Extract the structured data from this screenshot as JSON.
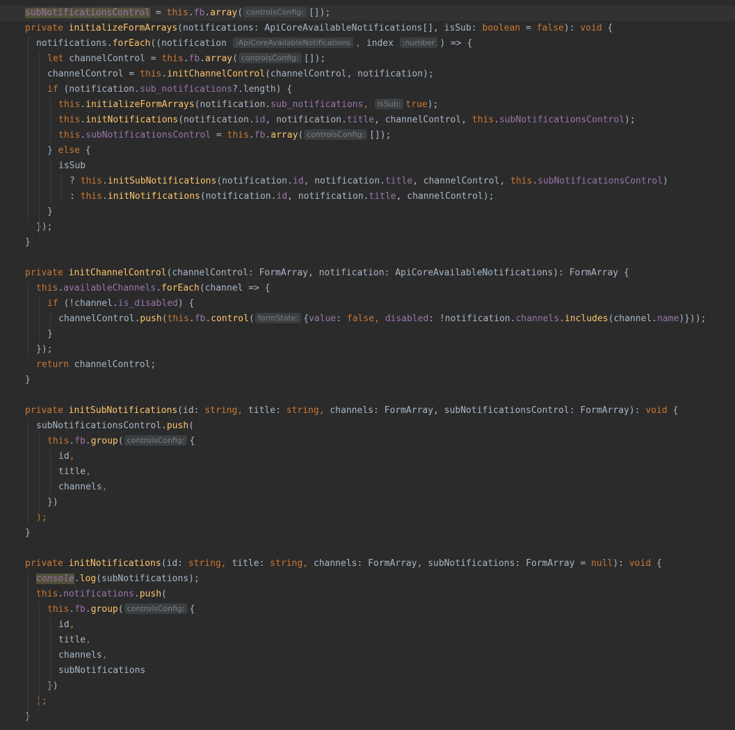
{
  "colors": {
    "background": "#2b2b2b",
    "keyword": "#cc7832",
    "function": "#ffc66d",
    "property": "#9876aa",
    "plain": "#a9b7c6",
    "hint_background": "#3b3f41",
    "hint_text": "#7a7e85",
    "selection_highlight": "#52503a"
  },
  "editor": {
    "lines": [
      {
        "indent": 0,
        "segments": [
          [
            "subNotificationsControl",
            "p hl"
          ],
          [
            " = ",
            "t"
          ],
          [
            "this",
            "k"
          ],
          [
            ".",
            "t"
          ],
          [
            "fb",
            "p"
          ],
          [
            ".",
            "t"
          ],
          [
            "array",
            "fn"
          ],
          [
            "(",
            "t"
          ],
          [
            "controlsConfig:",
            "hint"
          ],
          [
            "[]);",
            "t"
          ]
        ]
      },
      {
        "indent": 0,
        "segments": [
          [
            "private ",
            "k"
          ],
          [
            "initializeFormArrays",
            "fn"
          ],
          [
            "(notifications: ApiCoreAvailableNotifications[], isSub: ",
            "t"
          ],
          [
            "boolean",
            "k"
          ],
          [
            " = ",
            "t"
          ],
          [
            "false",
            "k"
          ],
          [
            "): ",
            "t"
          ],
          [
            "void",
            "k"
          ],
          [
            " {",
            "t"
          ]
        ]
      },
      {
        "indent": 1,
        "segments": [
          [
            "notifications.",
            "t"
          ],
          [
            "forEach",
            "fn"
          ],
          [
            "((notification ",
            "t"
          ],
          [
            ":ApiCoreAvailableNotifications",
            "hint"
          ],
          [
            ", ",
            "k"
          ],
          [
            "index ",
            "t"
          ],
          [
            ":number",
            "hint"
          ],
          [
            ") => {",
            "t"
          ]
        ]
      },
      {
        "indent": 2,
        "segments": [
          [
            "let ",
            "k"
          ],
          [
            "channelControl = ",
            "t"
          ],
          [
            "this",
            "k"
          ],
          [
            ".",
            "t"
          ],
          [
            "fb",
            "p"
          ],
          [
            ".",
            "t"
          ],
          [
            "array",
            "fn"
          ],
          [
            "(",
            "t"
          ],
          [
            "controlsConfig:",
            "hint"
          ],
          [
            "[]);",
            "t"
          ]
        ]
      },
      {
        "indent": 2,
        "segments": [
          [
            "channelControl = ",
            "t"
          ],
          [
            "this",
            "k"
          ],
          [
            ".",
            "t"
          ],
          [
            "initChannelControl",
            "fn"
          ],
          [
            "(channelControl, notification);",
            "t"
          ]
        ]
      },
      {
        "indent": 2,
        "segments": [
          [
            "if ",
            "k"
          ],
          [
            "(notification.",
            "t"
          ],
          [
            "sub_notifications",
            "p"
          ],
          [
            "?.length) {",
            "t"
          ]
        ]
      },
      {
        "indent": 3,
        "segments": [
          [
            "this",
            "k"
          ],
          [
            ".",
            "t"
          ],
          [
            "initializeFormArrays",
            "fn"
          ],
          [
            "(notification.",
            "t"
          ],
          [
            "sub_notifications",
            "p"
          ],
          [
            ", ",
            "k"
          ],
          [
            "isSub:",
            "hint"
          ],
          [
            "true",
            "k"
          ],
          [
            ");",
            "t"
          ]
        ]
      },
      {
        "indent": 3,
        "segments": [
          [
            "this",
            "k"
          ],
          [
            ".",
            "t"
          ],
          [
            "initNotifications",
            "fn"
          ],
          [
            "(notification.",
            "t"
          ],
          [
            "id",
            "p"
          ],
          [
            ", notification.",
            "t"
          ],
          [
            "title",
            "p"
          ],
          [
            ", channelControl, ",
            "t"
          ],
          [
            "this",
            "k"
          ],
          [
            ".",
            "t"
          ],
          [
            "subNotificationsControl",
            "p"
          ],
          [
            ");",
            "t"
          ]
        ]
      },
      {
        "indent": 3,
        "segments": [
          [
            "this",
            "k"
          ],
          [
            ".",
            "t"
          ],
          [
            "subNotificationsControl",
            "p"
          ],
          [
            " = ",
            "t"
          ],
          [
            "this",
            "k"
          ],
          [
            ".",
            "t"
          ],
          [
            "fb",
            "p"
          ],
          [
            ".",
            "t"
          ],
          [
            "array",
            "fn"
          ],
          [
            "(",
            "t"
          ],
          [
            "controlsConfig:",
            "hint"
          ],
          [
            "[]);",
            "t"
          ]
        ]
      },
      {
        "indent": 2,
        "segments": [
          [
            "} ",
            "t"
          ],
          [
            "else",
            "k"
          ],
          [
            " {",
            "t"
          ]
        ]
      },
      {
        "indent": 3,
        "segments": [
          [
            "isSub",
            "t"
          ]
        ]
      },
      {
        "indent": 4,
        "segments": [
          [
            "? ",
            "t"
          ],
          [
            "this",
            "k"
          ],
          [
            ".",
            "t"
          ],
          [
            "initSubNotifications",
            "fn"
          ],
          [
            "(notification.",
            "t"
          ],
          [
            "id",
            "p"
          ],
          [
            ", notification.",
            "t"
          ],
          [
            "title",
            "p"
          ],
          [
            ", channelControl, ",
            "t"
          ],
          [
            "this",
            "k"
          ],
          [
            ".",
            "t"
          ],
          [
            "subNotificationsControl",
            "p"
          ],
          [
            ")",
            "t"
          ]
        ]
      },
      {
        "indent": 4,
        "segments": [
          [
            ": ",
            "t"
          ],
          [
            "this",
            "k"
          ],
          [
            ".",
            "t"
          ],
          [
            "initNotifications",
            "fn"
          ],
          [
            "(notification.",
            "t"
          ],
          [
            "id",
            "p"
          ],
          [
            ", notification.",
            "t"
          ],
          [
            "title",
            "p"
          ],
          [
            ", channelControl);",
            "t"
          ]
        ]
      },
      {
        "indent": 2,
        "segments": [
          [
            "}",
            "t"
          ]
        ]
      },
      {
        "indent": 1,
        "segments": [
          [
            "});",
            "t"
          ]
        ]
      },
      {
        "indent": 0,
        "segments": [
          [
            "}",
            "t"
          ]
        ]
      },
      {
        "indent": 0,
        "segments": []
      },
      {
        "indent": 0,
        "segments": [
          [
            "private ",
            "k"
          ],
          [
            "initChannelControl",
            "fn"
          ],
          [
            "(channelControl: FormArray, notification: ApiCoreAvailableNotifications): FormArray {",
            "t"
          ]
        ]
      },
      {
        "indent": 1,
        "segments": [
          [
            "this",
            "k"
          ],
          [
            ".",
            "t"
          ],
          [
            "availableChannels",
            "p"
          ],
          [
            ".",
            "t"
          ],
          [
            "forEach",
            "fn"
          ],
          [
            "(channel => {",
            "t"
          ]
        ]
      },
      {
        "indent": 2,
        "segments": [
          [
            "if ",
            "k"
          ],
          [
            "(!channel.",
            "t"
          ],
          [
            "is_disabled",
            "p"
          ],
          [
            ") {",
            "t"
          ]
        ]
      },
      {
        "indent": 3,
        "segments": [
          [
            "channelControl.",
            "t"
          ],
          [
            "push",
            "fn"
          ],
          [
            "(",
            "t"
          ],
          [
            "this",
            "k"
          ],
          [
            ".",
            "t"
          ],
          [
            "fb",
            "p"
          ],
          [
            ".",
            "t"
          ],
          [
            "control",
            "fn"
          ],
          [
            "(",
            "t"
          ],
          [
            "formState:",
            "hint"
          ],
          [
            "{",
            "t"
          ],
          [
            "value",
            "p"
          ],
          [
            ": ",
            "t"
          ],
          [
            "false",
            "k"
          ],
          [
            ", ",
            "k"
          ],
          [
            "disabled",
            "p"
          ],
          [
            ": !notification.",
            "t"
          ],
          [
            "channels",
            "p"
          ],
          [
            ".",
            "t"
          ],
          [
            "includes",
            "fn"
          ],
          [
            "(channel.",
            "t"
          ],
          [
            "name",
            "p"
          ],
          [
            ")}));",
            "t"
          ]
        ]
      },
      {
        "indent": 2,
        "segments": [
          [
            "}",
            "t"
          ]
        ]
      },
      {
        "indent": 1,
        "segments": [
          [
            "});",
            "t"
          ]
        ]
      },
      {
        "indent": 1,
        "segments": [
          [
            "return ",
            "k"
          ],
          [
            "channelControl;",
            "t"
          ]
        ]
      },
      {
        "indent": 0,
        "segments": [
          [
            "}",
            "t"
          ]
        ]
      },
      {
        "indent": 0,
        "segments": []
      },
      {
        "indent": 0,
        "segments": [
          [
            "private ",
            "k"
          ],
          [
            "initSubNotifications",
            "fn"
          ],
          [
            "(id: ",
            "t"
          ],
          [
            "string",
            "k"
          ],
          [
            ", ",
            "k"
          ],
          [
            "title: ",
            "t"
          ],
          [
            "string",
            "k"
          ],
          [
            ", ",
            "k"
          ],
          [
            "channels: FormArray, subNotificationsControl: FormArray): ",
            "t"
          ],
          [
            "void",
            "k"
          ],
          [
            " {",
            "t"
          ]
        ]
      },
      {
        "indent": 1,
        "segments": [
          [
            "subNotificationsControl.",
            "t"
          ],
          [
            "push",
            "fn"
          ],
          [
            "(",
            "t"
          ]
        ]
      },
      {
        "indent": 2,
        "segments": [
          [
            "this",
            "k"
          ],
          [
            ".",
            "t"
          ],
          [
            "fb",
            "p"
          ],
          [
            ".",
            "t"
          ],
          [
            "group",
            "fn"
          ],
          [
            "(",
            "t"
          ],
          [
            "controlsConfig:",
            "hint"
          ],
          [
            "{",
            "t"
          ]
        ]
      },
      {
        "indent": 3,
        "segments": [
          [
            "id",
            "t"
          ],
          [
            ",",
            "k"
          ]
        ]
      },
      {
        "indent": 3,
        "segments": [
          [
            "title",
            "t"
          ],
          [
            ",",
            "k"
          ]
        ]
      },
      {
        "indent": 3,
        "segments": [
          [
            "channels",
            "t"
          ],
          [
            ",",
            "k"
          ]
        ]
      },
      {
        "indent": 2,
        "segments": [
          [
            "})",
            "t"
          ]
        ]
      },
      {
        "indent": 1,
        "segments": [
          [
            ");",
            "k"
          ]
        ]
      },
      {
        "indent": 0,
        "segments": [
          [
            "}",
            "t"
          ]
        ]
      },
      {
        "indent": 0,
        "segments": []
      },
      {
        "indent": 0,
        "segments": [
          [
            "private ",
            "k"
          ],
          [
            "initNotifications",
            "fn"
          ],
          [
            "(id: ",
            "t"
          ],
          [
            "string",
            "k"
          ],
          [
            ", ",
            "k"
          ],
          [
            "title: ",
            "t"
          ],
          [
            "string",
            "k"
          ],
          [
            ", ",
            "k"
          ],
          [
            "channels: FormArray, subNotifications: FormArray = ",
            "t"
          ],
          [
            "null",
            "k"
          ],
          [
            "): ",
            "t"
          ],
          [
            "void",
            "k"
          ],
          [
            " {",
            "t"
          ]
        ]
      },
      {
        "indent": 1,
        "segments": [
          [
            "console",
            "p it hl"
          ],
          [
            ".",
            "t"
          ],
          [
            "log",
            "fn"
          ],
          [
            "(subNotifications);",
            "t"
          ]
        ]
      },
      {
        "indent": 1,
        "segments": [
          [
            "this",
            "k"
          ],
          [
            ".",
            "t"
          ],
          [
            "notifications",
            "p"
          ],
          [
            ".",
            "t"
          ],
          [
            "push",
            "fn"
          ],
          [
            "(",
            "t"
          ]
        ]
      },
      {
        "indent": 2,
        "segments": [
          [
            "this",
            "k"
          ],
          [
            ".",
            "t"
          ],
          [
            "fb",
            "p"
          ],
          [
            ".",
            "t"
          ],
          [
            "group",
            "fn"
          ],
          [
            "(",
            "t"
          ],
          [
            "controlsConfig:",
            "hint"
          ],
          [
            "{",
            "t"
          ]
        ]
      },
      {
        "indent": 3,
        "segments": [
          [
            "id",
            "t"
          ],
          [
            ",",
            "k"
          ]
        ]
      },
      {
        "indent": 3,
        "segments": [
          [
            "title",
            "t"
          ],
          [
            ",",
            "k"
          ]
        ]
      },
      {
        "indent": 3,
        "segments": [
          [
            "channels",
            "t"
          ],
          [
            ",",
            "k"
          ]
        ]
      },
      {
        "indent": 3,
        "segments": [
          [
            "subNotifications",
            "t"
          ]
        ]
      },
      {
        "indent": 2,
        "segments": [
          [
            "})",
            "t"
          ]
        ]
      },
      {
        "indent": 1,
        "segments": [
          [
            ");",
            "k"
          ]
        ]
      },
      {
        "indent": 0,
        "segments": [
          [
            "}",
            "t"
          ]
        ]
      }
    ]
  }
}
